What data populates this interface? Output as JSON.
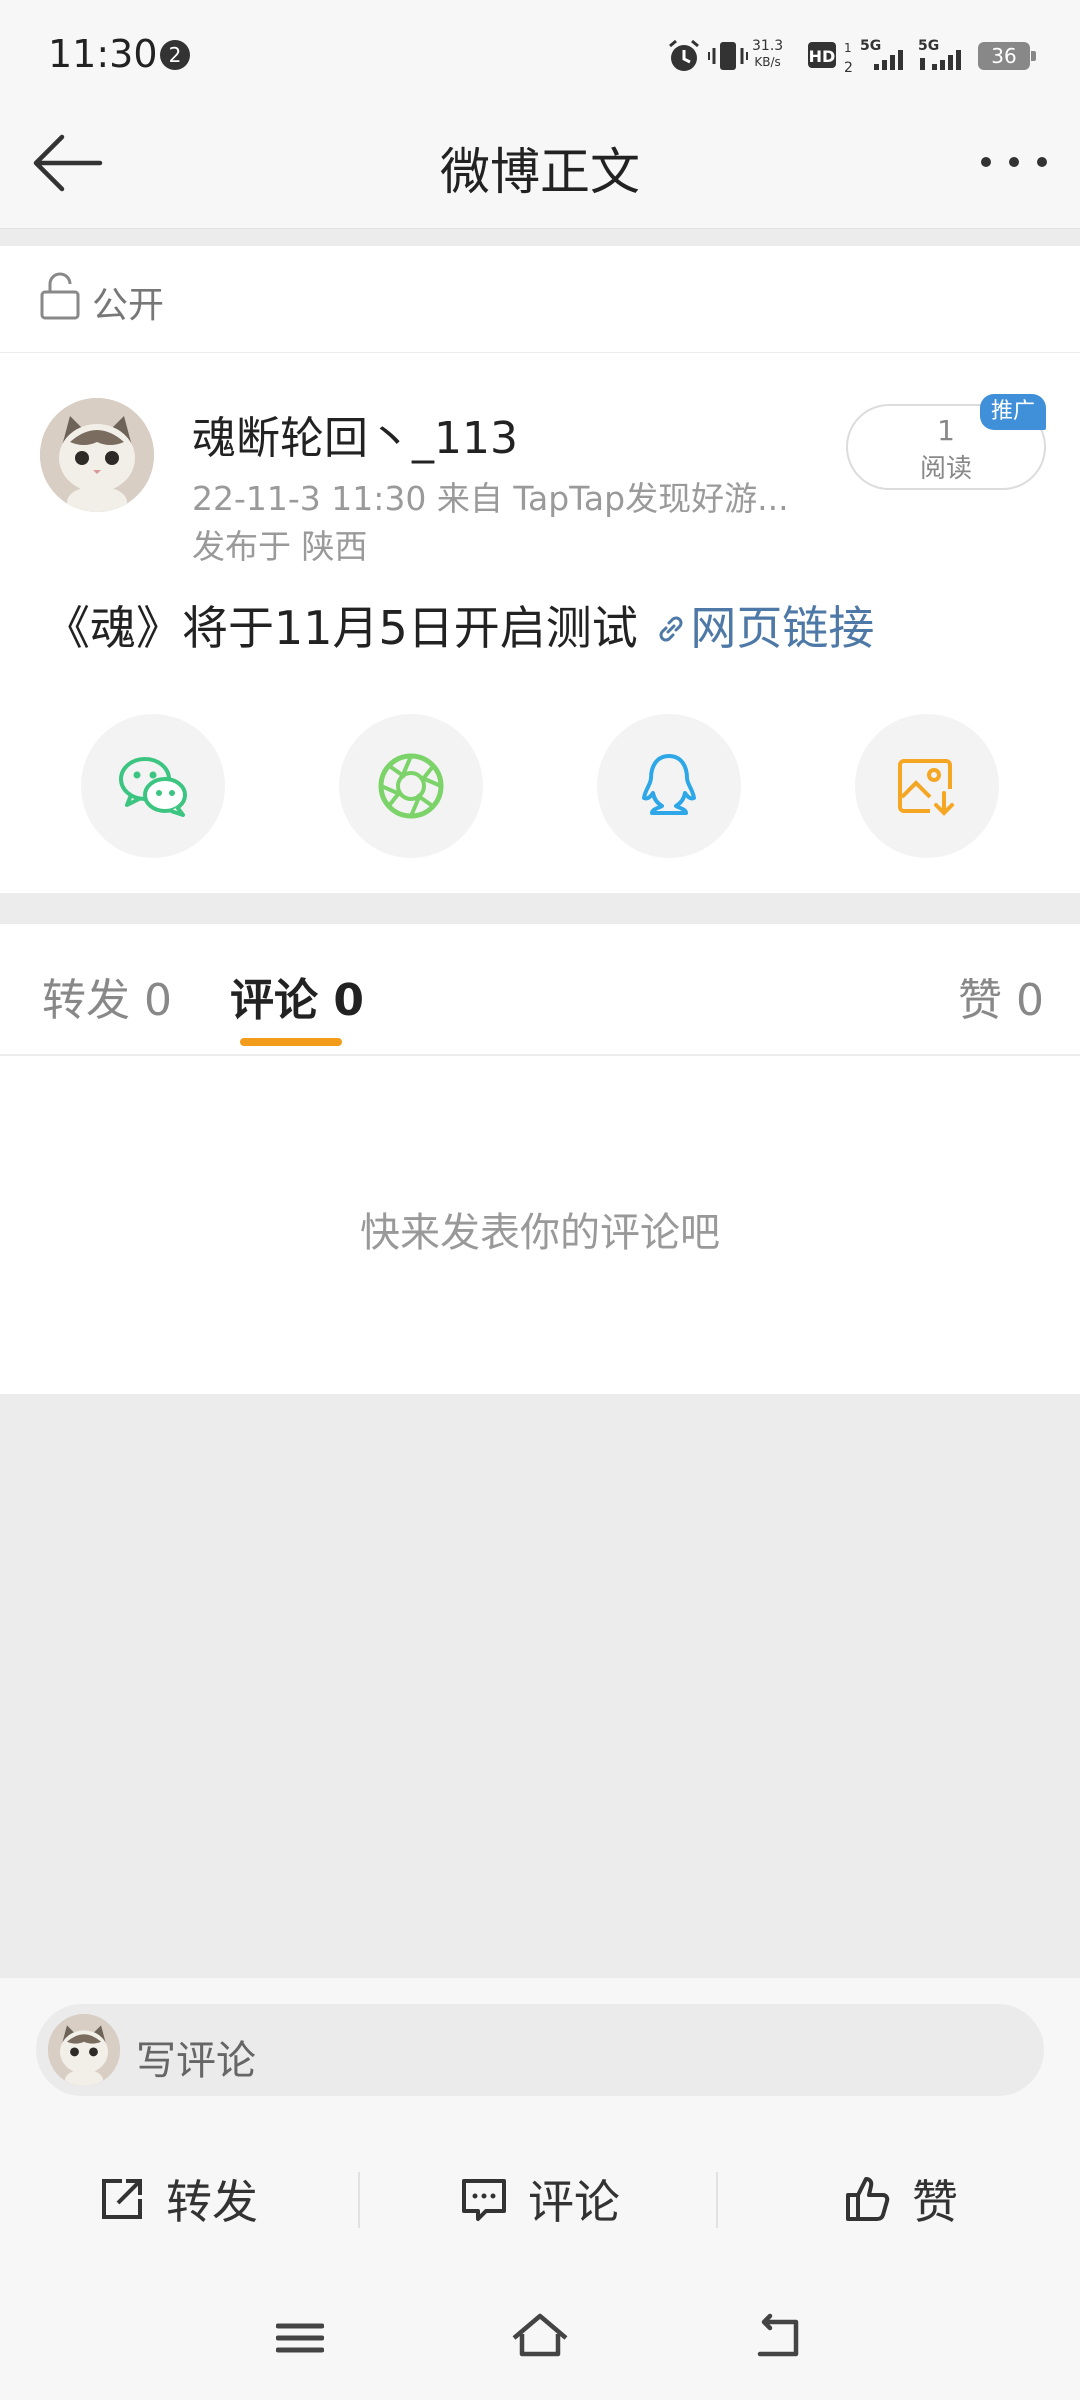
{
  "status_bar": {
    "time": "11:30",
    "notification_count": "2",
    "net_speed_value": "31.3",
    "net_speed_unit": "KB/s",
    "battery": "36"
  },
  "header": {
    "title": "微博正文"
  },
  "visibility": {
    "label": "公开"
  },
  "post": {
    "username": "魂断轮回丶_113",
    "meta": "22-11-3 11:30  来自 TapTap发现好游...",
    "location": "发布于 陕西",
    "read_count": "1",
    "read_label": "阅读",
    "promo_tag": "推广",
    "text": "《魂》将于11月5日开启测试 ",
    "link_text": "网页链接"
  },
  "share": {
    "items": [
      "wechat",
      "moments",
      "qq",
      "save-image"
    ],
    "colors": {
      "wechat": "#3cc481",
      "moments": "#7bd36a",
      "qq": "#2ea7e8",
      "save": "#f5a623"
    }
  },
  "tabs": {
    "repost": "转发 0",
    "comment": "评论 0",
    "like": "赞 0"
  },
  "comments": {
    "empty": "快来发表你的评论吧"
  },
  "composer": {
    "placeholder": "写评论"
  },
  "actions": {
    "repost": "转发",
    "comment": "评论",
    "like": "赞"
  },
  "theme": {
    "accent": "#f39b1b",
    "link": "#4e79a6",
    "promo": "#3f8fd9"
  }
}
